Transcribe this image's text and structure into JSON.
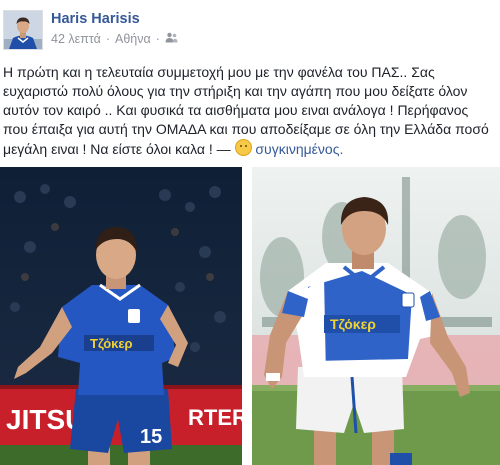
{
  "post": {
    "author": "Haris Harisis",
    "time": "42 λεπτά",
    "location": "Αθήνα",
    "text": "Η πρώτη και η τελευταία συμμετοχή μου με την φανέλα του ΠΑΣ.. Σας ευχαριστώ πολύ όλους για την στήριξη και την αγάπη που μου δείξατε όλον αυτόν τον καιρό .. Και φυσικά τα αισθήματα μου ειναι ανάλογα ! Περήφανος που έπαιξα για αυτή την ΟΜΑΔΑ και που αποδείξαμε σε όλη την Ελλάδα ποσό μεγάλη ειναι ! Να είστε όλοι καλα ! — ",
    "feeling": "συγκινημένος."
  },
  "photos": {
    "left": {
      "sponsor": "Τζόκερ",
      "number": "15",
      "ad_left": "JITSU",
      "ad_right": "RTER"
    },
    "right": {
      "sponsor": "Τζόκερ"
    }
  },
  "icons": {
    "privacy": "friends-icon",
    "separator": "dot-separator-icon"
  },
  "colors": {
    "name": "#365899",
    "meta": "#90949c",
    "text": "#1d2129",
    "jersey_blue": "#1f4fa8",
    "jersey_stripe": "#2f63c8"
  }
}
